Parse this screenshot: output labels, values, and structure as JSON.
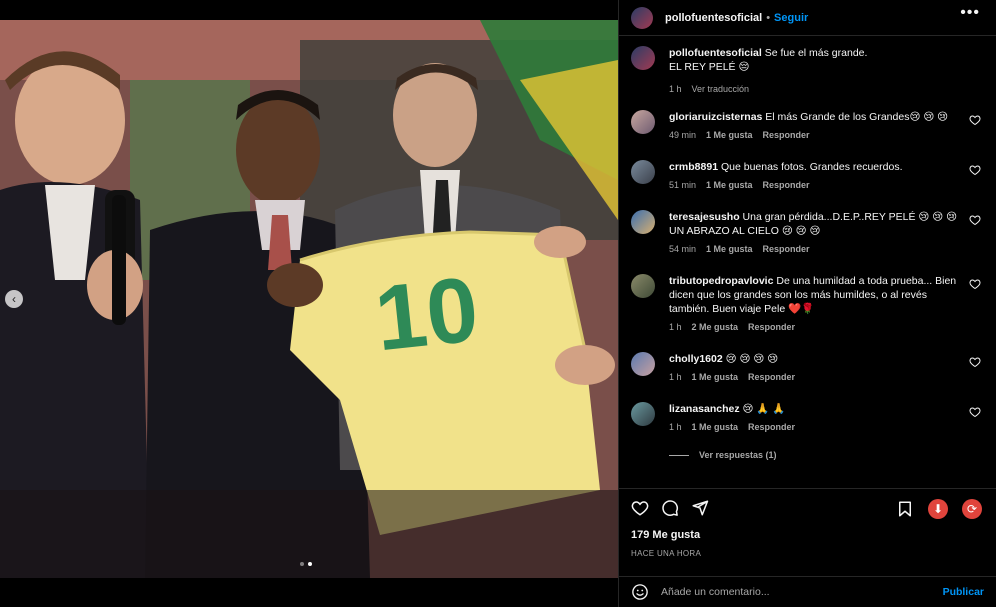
{
  "post": {
    "username": "pollofuentesoficial",
    "follow_label": "Seguir",
    "more_icon": "more-horizontal-icon",
    "carousel": {
      "prev_icon": "chevron-left-icon",
      "total": 2,
      "active": 2
    }
  },
  "caption": {
    "username": "pollofuentesoficial",
    "text_line1": "Se fue el más grande.",
    "text_line2": "EL REY PELÉ 😔",
    "time": "1 h",
    "translate_label": "Ver traducción"
  },
  "comments": [
    {
      "username": "gloriaruizcisternas",
      "text": "El más Grande de los Grandes😢 😢 😢",
      "time": "49 min",
      "likes": "1 Me gusta",
      "reply": "Responder"
    },
    {
      "username": "crmb8891",
      "text": "Que buenas fotos. Grandes recuerdos.",
      "time": "51 min",
      "likes": "1 Me gusta",
      "reply": "Responder"
    },
    {
      "username": "teresajesusho",
      "text": "Una gran pérdida...D.E.P..REY PELÉ 😢 😢 😢 UN ABRAZO AL CIELO 😢 😢 😢",
      "time": "54 min",
      "likes": "1 Me gusta",
      "reply": "Responder"
    },
    {
      "username": "tributopedropavlovic",
      "text": "De una humildad a toda prueba... Bien dicen que los grandes son los más humildes, o al revés también. Buen viaje Pele ❤️🌹",
      "time": "1 h",
      "likes": "2 Me gusta",
      "reply": "Responder"
    },
    {
      "username": "cholly1602",
      "text": "😢 😢 😢 😢",
      "time": "1 h",
      "likes": "1 Me gusta",
      "reply": "Responder"
    },
    {
      "username": "lizanasanchez",
      "text": "😢 🙏 🙏",
      "time": "1 h",
      "likes": "1 Me gusta",
      "reply": "Responder"
    }
  ],
  "view_replies": "Ver respuestas (1)",
  "actions": {
    "like_icon": "heart-icon",
    "comment_icon": "comment-icon",
    "share_icon": "send-icon",
    "save_icon": "bookmark-icon",
    "download_icon": "download-icon",
    "repost_icon": "repost-icon",
    "likes_text": "179 Me gusta",
    "time_ago": "HACE UNA HORA"
  },
  "add_comment": {
    "placeholder": "Añade un comentario...",
    "publish_label": "Publicar",
    "emoji_icon": "emoji-icon"
  },
  "colors": {
    "accent": "#0095f6",
    "download": "#e0443c",
    "repost": "#e0443c"
  }
}
